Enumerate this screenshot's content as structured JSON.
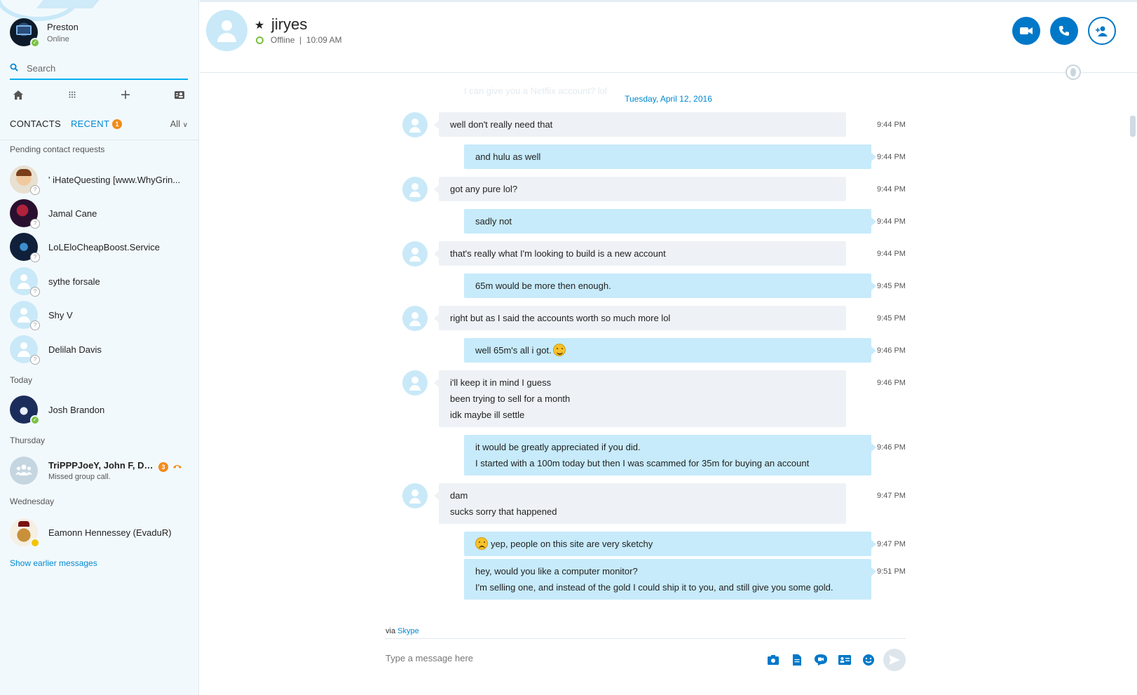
{
  "self": {
    "name": "Preston",
    "status": "Online"
  },
  "search": {
    "placeholder": "Search"
  },
  "tabs": {
    "contacts": "CONTACTS",
    "recent": "RECENT",
    "recent_badge": "1",
    "filter": "All"
  },
  "sections": {
    "pending": "Pending contact requests",
    "today": "Today",
    "thursday": "Thursday",
    "wednesday": "Wednesday"
  },
  "pending_contacts": [
    {
      "name": "'   iHateQuesting [www.WhyGrin..."
    },
    {
      "name": "Jamal Cane"
    },
    {
      "name": "LoLEloCheapBoost.Service"
    },
    {
      "name": "sythe forsale"
    },
    {
      "name": "Shy V"
    },
    {
      "name": "Delilah Davis"
    }
  ],
  "today_contacts": [
    {
      "name": "Josh Brandon"
    }
  ],
  "thursday_contacts": [
    {
      "name": "TriPPPJoeY, John F, De...",
      "sub": "Missed group call.",
      "badge": "3"
    }
  ],
  "wednesday_contacts": [
    {
      "name": "Eamonn Hennessey (EvaduR)"
    }
  ],
  "show_earlier": "Show earlier messages",
  "conversation": {
    "name": "jiryes",
    "status": "Offline  |  10:09 AM",
    "faded_message": "I can give you a Netflix account? lol",
    "date": "Tuesday, April 12, 2016",
    "messages": [
      {
        "dir": "in",
        "lines": [
          "well don't really need that"
        ],
        "time": "9:44 PM"
      },
      {
        "dir": "out",
        "lines": [
          "and hulu as well"
        ],
        "time": "9:44 PM"
      },
      {
        "dir": "in",
        "lines": [
          "got any pure lol?"
        ],
        "time": "9:44 PM"
      },
      {
        "dir": "out",
        "lines": [
          "sadly not"
        ],
        "time": "9:44 PM"
      },
      {
        "dir": "in",
        "lines": [
          "that's really what I'm looking to build is a new account"
        ],
        "time": "9:44 PM"
      },
      {
        "dir": "out",
        "lines": [
          "65m would be more then enough."
        ],
        "time": "9:45 PM"
      },
      {
        "dir": "in",
        "lines": [
          "right but as I said the accounts worth so much more lol"
        ],
        "time": "9:45 PM"
      },
      {
        "dir": "out",
        "lines": [
          "well 65m's all i got."
        ],
        "time": "9:46 PM",
        "emoji": "smile"
      },
      {
        "dir": "in",
        "lines": [
          "i'll keep it in mind I guess",
          "been trying to sell for a month",
          "idk maybe ill settle"
        ],
        "time": "9:46 PM"
      },
      {
        "dir": "out",
        "lines": [
          "it would be greatly appreciated if you did.",
          "I started with a 100m today but then I was scammed for 35m for buying an account"
        ],
        "time": "9:46 PM"
      },
      {
        "dir": "in",
        "lines": [
          "dam",
          "sucks sorry that happened"
        ],
        "time": "9:47 PM"
      },
      {
        "dir": "out",
        "lines": [
          "yep, people on this site are very sketchy"
        ],
        "time": "9:47 PM",
        "emoji_before": "sad"
      },
      {
        "dir": "out",
        "lines": [
          "hey, would you like a computer monitor?",
          "I'm selling one, and instead of the gold I could ship it to you, and still give you some gold."
        ],
        "time": "9:51 PM"
      }
    ]
  },
  "via": {
    "prefix": "via",
    "link": "Skype"
  },
  "composer": {
    "placeholder": "Type a message here"
  },
  "icons": {
    "search": "search-icon",
    "home": "home-icon",
    "dialpad": "dialpad-icon",
    "add": "plus-icon",
    "contacts_book": "phone-book-icon",
    "video": "video-camera-icon",
    "call": "phone-icon",
    "add_person": "add-person-icon",
    "send": "send-icon"
  },
  "colors": {
    "accent": "#0078c8",
    "link": "#0089d0",
    "outgoing_bubble": "#c7ebfb",
    "incoming_bubble": "#eef2f6",
    "online": "#7ac142",
    "badge": "#f28c1b"
  }
}
